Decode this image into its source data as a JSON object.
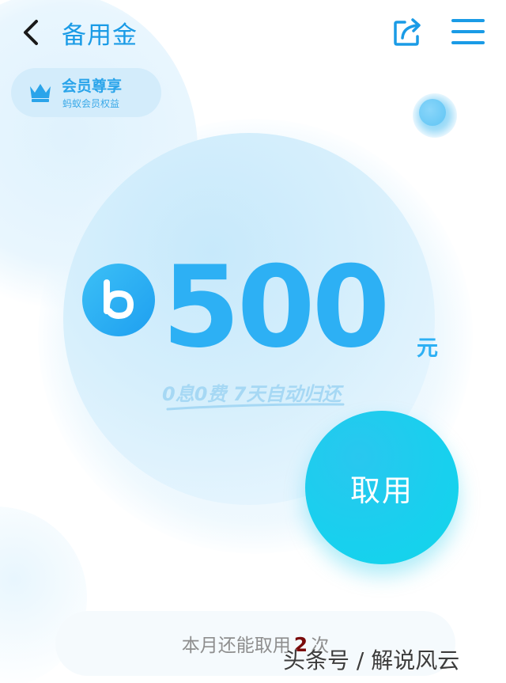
{
  "header": {
    "title": "备用金",
    "back_icon": "chevron-left-icon",
    "share_icon": "share-icon",
    "menu_icon": "hamburger-menu-icon"
  },
  "member_badge": {
    "title": "会员尊享",
    "subtitle": "蚂蚁会员权益",
    "icon": "crown-icon"
  },
  "amount": {
    "value": "500",
    "currency": "元",
    "logo": "b-logo-icon",
    "slogan": "0息0费 7天自动归还"
  },
  "withdraw": {
    "label": "取用"
  },
  "remaining": {
    "prefix": "本月还能取用",
    "count": "2",
    "suffix": "次"
  },
  "watermark": "头条号 / 解说风云",
  "colors": {
    "primary": "#2db0f4",
    "title": "#1a9be6",
    "button": "#18d0ee",
    "badge_bg": "#d3ecfb",
    "count": "#7a0b0b"
  }
}
